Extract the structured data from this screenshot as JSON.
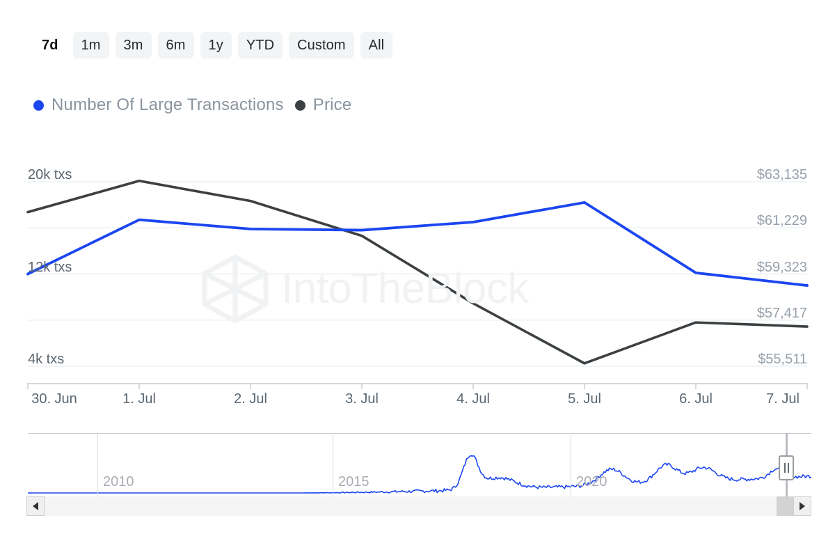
{
  "range_selector": {
    "buttons": [
      {
        "label": "7d",
        "active": true
      },
      {
        "label": "1m",
        "active": false
      },
      {
        "label": "3m",
        "active": false
      },
      {
        "label": "6m",
        "active": false
      },
      {
        "label": "1y",
        "active": false
      },
      {
        "label": "YTD",
        "active": false
      },
      {
        "label": "Custom",
        "active": false
      },
      {
        "label": "All",
        "active": false
      }
    ]
  },
  "legend": {
    "items": [
      {
        "label": "Number Of Large Transactions",
        "color": "#1b46f0",
        "icon": "legend-dot-icon"
      },
      {
        "label": "Price",
        "color": "#3c4043",
        "icon": "legend-dot-icon"
      }
    ]
  },
  "watermark": {
    "text": "IntoTheBlock",
    "logo": "intotheblock-cube-logo"
  },
  "navigator": {
    "years": [
      "2010",
      "2015",
      "2020"
    ],
    "handle": "right-range-handle",
    "scrollbar": {
      "left_arrow": "scroll-left-arrow-icon",
      "right_arrow": "scroll-right-arrow-icon"
    }
  },
  "chart_data": {
    "type": "line",
    "title": "",
    "xlabel": "",
    "grid": true,
    "legend_position": "top-left",
    "x": [
      "30. Jun",
      "1. Jul",
      "2. Jul",
      "3. Jul",
      "4. Jul",
      "5. Jul",
      "6. Jul",
      "7. Jul"
    ],
    "xtick_labels": [
      "30. Jun",
      "1. Jul",
      "2. Jul",
      "3. Jul",
      "4. Jul",
      "5. Jul",
      "6. Jul",
      "7. Jul"
    ],
    "left_axis": {
      "label": "Number Of Large Transactions",
      "tick_labels": [
        "20k txs",
        "12k txs",
        "4k txs"
      ],
      "tick_values": [
        20000,
        12000,
        4000
      ],
      "ylim": [
        2400,
        21600
      ]
    },
    "right_axis": {
      "label": "Price",
      "tick_labels": [
        "$63,135",
        "$61,229",
        "$59,323",
        "$57,417",
        "$55,511"
      ],
      "tick_values": [
        63135,
        61229,
        59323,
        57417,
        55511
      ],
      "ylim": [
        54939,
        63707
      ]
    },
    "series": [
      {
        "name": "Number Of Large Transactions",
        "color": "#1b46f0",
        "axis": "left",
        "unit": "txs",
        "values": [
          12000,
          16700,
          15900,
          15800,
          16500,
          18200,
          12100,
          11000
        ]
      },
      {
        "name": "Price",
        "color": "#3c4043",
        "axis": "right",
        "unit": "USD",
        "values": [
          61880,
          63170,
          62340,
          60900,
          58110,
          55630,
          57320,
          57150
        ]
      }
    ],
    "navigator_series": {
      "name": "Number Of Large Transactions",
      "color": "#1b46f0",
      "range": "All"
    }
  }
}
